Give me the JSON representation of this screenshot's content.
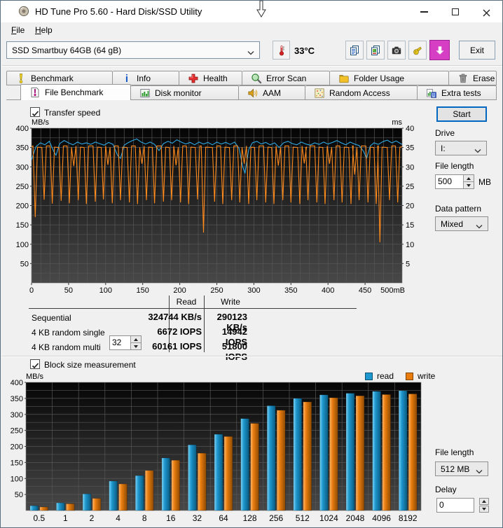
{
  "window": {
    "title": "HD Tune Pro 5.60 - Hard Disk/SSD Utility",
    "controls": [
      "minimize-icon",
      "maximize-icon",
      "close-icon"
    ],
    "app_icon": "disk-icon"
  },
  "menu": {
    "items": [
      {
        "label": "File"
      },
      {
        "label": "Help"
      }
    ]
  },
  "toolbar": {
    "device": "SSD Smartbuy 64GB (64 gB)",
    "temperature": "33°C",
    "thermometer_icon": "thermometer-icon",
    "buttons": [
      {
        "icon": "copy-text-icon"
      },
      {
        "icon": "copy-image-icon"
      },
      {
        "icon": "camera-icon"
      },
      {
        "icon": "hand-icon"
      }
    ],
    "download_icon": "download-icon",
    "download_color": "#d63ec4",
    "exit_label": "Exit"
  },
  "tabs": {
    "active": "File Benchmark",
    "row1": [
      {
        "label": "Benchmark",
        "icon": "benchmark-icon"
      },
      {
        "label": "Info",
        "icon": "info-icon"
      },
      {
        "label": "Health",
        "icon": "health-icon"
      },
      {
        "label": "Error Scan",
        "icon": "error-scan-icon"
      },
      {
        "label": "Folder Usage",
        "icon": "folder-usage-icon"
      },
      {
        "label": "Erase",
        "icon": "erase-icon"
      }
    ],
    "row2": [
      {
        "label": "File Benchmark",
        "icon": "file-benchmark-icon"
      },
      {
        "label": "Disk monitor",
        "icon": "disk-monitor-icon"
      },
      {
        "label": "AAM",
        "icon": "aam-icon"
      },
      {
        "label": "Random Access",
        "icon": "random-access-icon"
      },
      {
        "label": "Extra tests",
        "icon": "extra-tests-icon"
      }
    ]
  },
  "panel": {
    "transfer_speed_label": "Transfer speed",
    "block_size_label": "Block size measurement",
    "start_label": "Start",
    "drive_label": "Drive",
    "drive_value": "I:",
    "file_length_label": "File length",
    "file_length_value": "500",
    "mb_label": "MB",
    "data_pattern_label": "Data pattern",
    "data_pattern_value": "Mixed",
    "file_length2_label": "File length",
    "file_length2_value": "512 MB",
    "delay_label": "Delay",
    "delay_value": "0"
  },
  "results_table": {
    "columns": [
      "Read",
      "Write"
    ],
    "rows": [
      {
        "label": "Sequential",
        "read": "324744 KB/s",
        "write": "290123 KB/s"
      },
      {
        "label": "4 KB random single",
        "read": "6672 IOPS",
        "write": "14942 IOPS"
      },
      {
        "label": "4 KB random multi",
        "spinner": "32",
        "read": "60161 IOPS",
        "write": "51800 IOPS"
      }
    ]
  },
  "chart_data": [
    {
      "type": "line",
      "title": "Transfer speed",
      "y_left_label": "MB/s",
      "y_right_label": "ms",
      "y_left_ticks": [
        400,
        350,
        300,
        250,
        200,
        150,
        100,
        50
      ],
      "y_right_ticks": [
        40,
        35,
        30,
        25,
        20,
        15,
        10,
        5
      ],
      "x_ticks": [
        0,
        50,
        100,
        150,
        200,
        250,
        300,
        350,
        400,
        450
      ],
      "x_last_tick": "500mB",
      "x_range": [
        0,
        500
      ],
      "y_range": [
        0,
        400
      ],
      "grid": true,
      "background": [
        "#050505",
        "#484848"
      ],
      "grid_color": "#565656",
      "series": [
        {
          "name": "read",
          "color": "#2fa8e1",
          "points": [
            [
              0,
              318
            ],
            [
              6,
              352
            ],
            [
              12,
              362
            ],
            [
              18,
              357
            ],
            [
              24,
              366
            ],
            [
              30,
              340
            ],
            [
              33,
              330
            ],
            [
              38,
              360
            ],
            [
              44,
              368
            ],
            [
              50,
              362
            ],
            [
              56,
              357
            ],
            [
              62,
              364
            ],
            [
              68,
              359
            ],
            [
              74,
              362
            ],
            [
              80,
              358
            ],
            [
              86,
              364
            ],
            [
              92,
              360
            ],
            [
              98,
              356
            ],
            [
              104,
              363
            ],
            [
              110,
              358
            ],
            [
              116,
              330
            ],
            [
              120,
              322
            ],
            [
              125,
              356
            ],
            [
              130,
              362
            ],
            [
              136,
              368
            ],
            [
              142,
              372
            ],
            [
              148,
              364
            ],
            [
              154,
              359
            ],
            [
              160,
              364
            ],
            [
              166,
              358
            ],
            [
              172,
              342
            ],
            [
              178,
              360
            ],
            [
              184,
              366
            ],
            [
              190,
              361
            ],
            [
              196,
              370
            ],
            [
              202,
              364
            ],
            [
              208,
              359
            ],
            [
              214,
              363
            ],
            [
              220,
              357
            ],
            [
              226,
              364
            ],
            [
              232,
              359
            ],
            [
              238,
              363
            ],
            [
              244,
              357
            ],
            [
              250,
              364
            ],
            [
              256,
              359
            ],
            [
              262,
              363
            ],
            [
              268,
              358
            ],
            [
              274,
              364
            ],
            [
              280,
              348
            ],
            [
              285,
              300
            ],
            [
              288,
              283
            ],
            [
              293,
              345
            ],
            [
              298,
              362
            ],
            [
              304,
              366
            ],
            [
              310,
              359
            ],
            [
              316,
              363
            ],
            [
              322,
              357
            ],
            [
              328,
              362
            ],
            [
              334,
              350
            ],
            [
              340,
              362
            ],
            [
              346,
              366
            ],
            [
              352,
              360
            ],
            [
              358,
              357
            ],
            [
              364,
              364
            ],
            [
              370,
              359
            ],
            [
              376,
              356
            ],
            [
              382,
              362
            ],
            [
              388,
              358
            ],
            [
              394,
              364
            ],
            [
              400,
              359
            ],
            [
              406,
              363
            ],
            [
              412,
              368
            ],
            [
              418,
              362
            ],
            [
              424,
              357
            ],
            [
              430,
              364
            ],
            [
              436,
              359
            ],
            [
              442,
              355
            ],
            [
              448,
              340
            ],
            [
              452,
              322
            ],
            [
              457,
              354
            ],
            [
              462,
              362
            ],
            [
              468,
              358
            ],
            [
              474,
              365
            ],
            [
              480,
              369
            ],
            [
              486,
              362
            ],
            [
              492,
              367
            ],
            [
              498,
              360
            ],
            [
              500,
              358
            ]
          ]
        },
        {
          "name": "write",
          "color": "#ff8a1c",
          "baseline": 352,
          "dips": [
            [
              5,
              170
            ],
            [
              17,
              215
            ],
            [
              28,
              205
            ],
            [
              40,
              212
            ],
            [
              51,
              206
            ],
            [
              57,
              302
            ],
            [
              63,
              214
            ],
            [
              74,
              204
            ],
            [
              86,
              210
            ],
            [
              97,
              216
            ],
            [
              103,
              305
            ],
            [
              109,
              206
            ],
            [
              120,
              214
            ],
            [
              132,
              208
            ],
            [
              143,
              204
            ],
            [
              149,
              308
            ],
            [
              155,
              214
            ],
            [
              166,
              206
            ],
            [
              178,
              210
            ],
            [
              189,
              214
            ],
            [
              195,
              304
            ],
            [
              201,
              208
            ],
            [
              212,
              204
            ],
            [
              224,
              216
            ],
            [
              232,
              130
            ],
            [
              247,
              210
            ],
            [
              258,
              204
            ],
            [
              270,
              214
            ],
            [
              281,
              208
            ],
            [
              287,
              308
            ],
            [
              293,
              204
            ],
            [
              304,
              214
            ],
            [
              316,
              208
            ],
            [
              327,
              204
            ],
            [
              333,
              303
            ],
            [
              339,
              214
            ],
            [
              350,
              208
            ],
            [
              362,
              204
            ],
            [
              368,
              309
            ],
            [
              373,
              214
            ],
            [
              385,
              208
            ],
            [
              396,
              204
            ],
            [
              402,
              308
            ],
            [
              408,
              214
            ],
            [
              419,
              208
            ],
            [
              431,
              204
            ],
            [
              436,
              280
            ],
            [
              442,
              214
            ],
            [
              454,
              208
            ],
            [
              465,
              204
            ],
            [
              470,
              105
            ],
            [
              483,
              214
            ],
            [
              494,
              208
            ]
          ]
        }
      ]
    },
    {
      "type": "bar",
      "title": "Block size measurement",
      "ylabel": "MB/s",
      "y_ticks": [
        400,
        350,
        300,
        250,
        200,
        150,
        100,
        50
      ],
      "y_range": [
        0,
        400
      ],
      "categories": [
        "0.5",
        "1",
        "2",
        "4",
        "8",
        "16",
        "32",
        "64",
        "128",
        "256",
        "512",
        "1024",
        "2048",
        "4096",
        "8192"
      ],
      "legend": [
        "read",
        "write"
      ],
      "legend_position": "top-right",
      "background": [
        "#050505",
        "#484848"
      ],
      "grid_color": "#565656",
      "series": [
        {
          "name": "read",
          "color": "#1e97ce",
          "values": [
            15,
            24,
            52,
            92,
            109,
            164,
            205,
            238,
            287,
            327,
            350,
            361,
            366,
            372,
            374
          ]
        },
        {
          "name": "write",
          "color": "#e87c0e",
          "values": [
            11,
            21,
            38,
            83,
            125,
            157,
            179,
            231,
            272,
            313,
            339,
            352,
            358,
            362,
            364
          ]
        }
      ]
    }
  ]
}
